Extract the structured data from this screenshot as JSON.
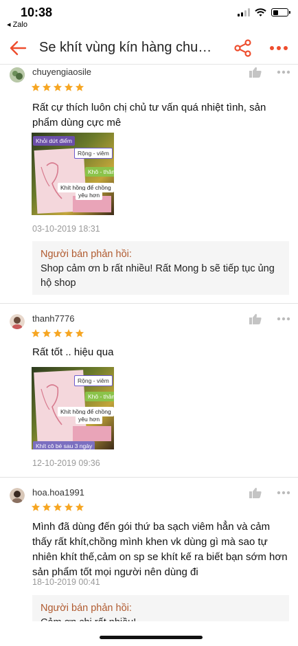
{
  "status_bar": {
    "time": "10:38",
    "back_app": "◂ Zalo"
  },
  "header": {
    "title": "Se khít vùng kín hàng chu…"
  },
  "reviews": [
    {
      "username": "chuyengiaosile",
      "rating": 5,
      "text": "Rất cự thích luôn chị chủ tư vấn quá nhiệt tình, sản phẩm dùng cực mê",
      "image_tags": [
        "Khỏi dứt điểm",
        "Rộng - viêm",
        "Khô - thâm",
        "Khít hồng để chồng",
        "yêu hơn"
      ],
      "date": "03-10-2019 18:31",
      "seller_reply": {
        "title": "Người bán phản hồi:",
        "body": "Shop cảm ơn b rất nhiều! Rất Mong b sẽ tiếp tục ủng hộ shop"
      }
    },
    {
      "username": "thanh7776",
      "rating": 5,
      "text": "Rất tốt .. hiệu qua",
      "image_tags": [
        "Rộng - viêm",
        "Khô - thâm",
        "Khít hồng để chồng",
        "yêu hơn",
        "Khít cô bé sau 3 ngày"
      ],
      "date": "12-10-2019 09:36"
    },
    {
      "username": "hoa.hoa1991",
      "rating": 5,
      "text": "Mình đã dùng đến gói thứ ba sạch viêm hẳn và cảm thấy rất khít,chồng mình khen vk dùng gì mà sao tự nhiên khít thế,cảm on sp se khít kế ra biết bạn sớm hơn sản phẩm tốt mọi người nên dùng đi",
      "date": "18-10-2019 00:41",
      "seller_reply": {
        "title": "Người bán phản hồi:",
        "body": "Cảm ơn chị rất nhiều!"
      }
    }
  ],
  "colors": {
    "accent": "#ee4d2d",
    "star": "#f6a623",
    "seller_title": "#b05a2f"
  }
}
